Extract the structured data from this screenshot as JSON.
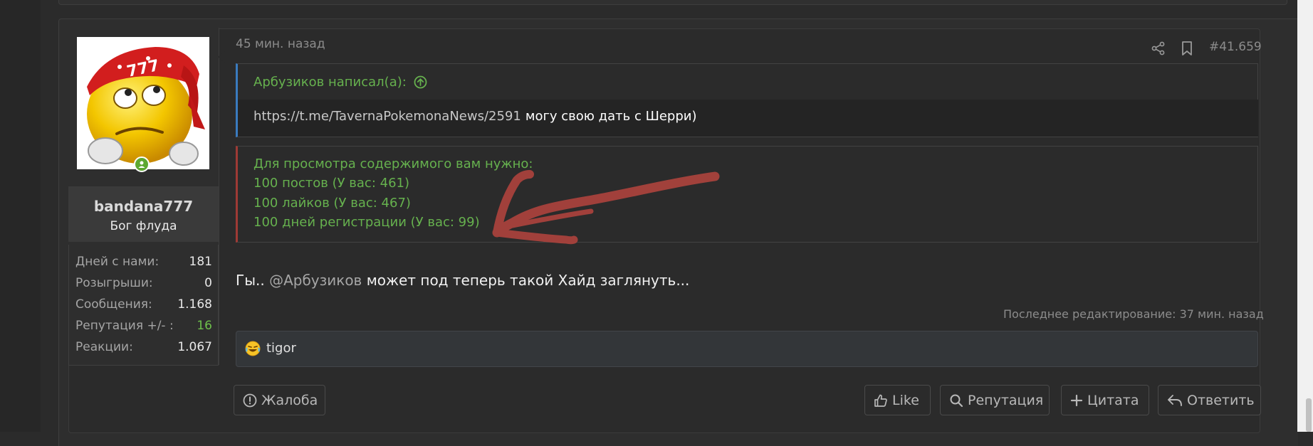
{
  "post": {
    "time": "45 мин. назад",
    "number": "#41.659",
    "message_start": "Гы..",
    "mention": "@Арбузиков",
    "message_end": "может под теперь такой Хайд заглянуть...",
    "last_edit": "Последнее редактирование: 37 мин. назад"
  },
  "user": {
    "name": "bandana777",
    "title": "Бог флуда",
    "stats": [
      {
        "label": "Дней с нами:",
        "value": "181"
      },
      {
        "label": "Розыгрыши:",
        "value": "0"
      },
      {
        "label": "Сообщения:",
        "value": "1.168"
      },
      {
        "label": "Репутация +/- :",
        "value": "16"
      },
      {
        "label": "Реакции:",
        "value": "1.067"
      }
    ]
  },
  "quote": {
    "author_line": "Арбузиков написал(а):",
    "link": "https://t.me/TavernaPokemonaNews/2591",
    "text": "могу свою дать с Шерри)"
  },
  "hide": {
    "lines": [
      "Для просмотра содержимого вам нужно:",
      "100 постов (У вас: 461)",
      "100 лайков (У вас: 467)",
      "100 дней регистрации (У вас: 99)"
    ]
  },
  "reactions": {
    "users": "tigor"
  },
  "actions": {
    "report": "Жалоба",
    "like": "Like",
    "reputation": "Репутация",
    "quote": "Цитата",
    "reply": "Ответить"
  },
  "colors": {
    "accent_green": "#66b14e",
    "quote_border": "#3a7bbf",
    "hide_border": "#9e3a35",
    "annotation_arrow": "#a8423c"
  },
  "icons": {
    "share": "share-icon",
    "bookmark": "bookmark-icon",
    "quote_jump": "arrow-circle-up-icon",
    "report": "alert-circle-icon",
    "like": "thumbs-up-icon",
    "reputation": "search-icon",
    "quote": "plus-icon",
    "reply": "reply-icon",
    "reaction": "laughing-emoji-icon",
    "online": "online-status-icon"
  }
}
